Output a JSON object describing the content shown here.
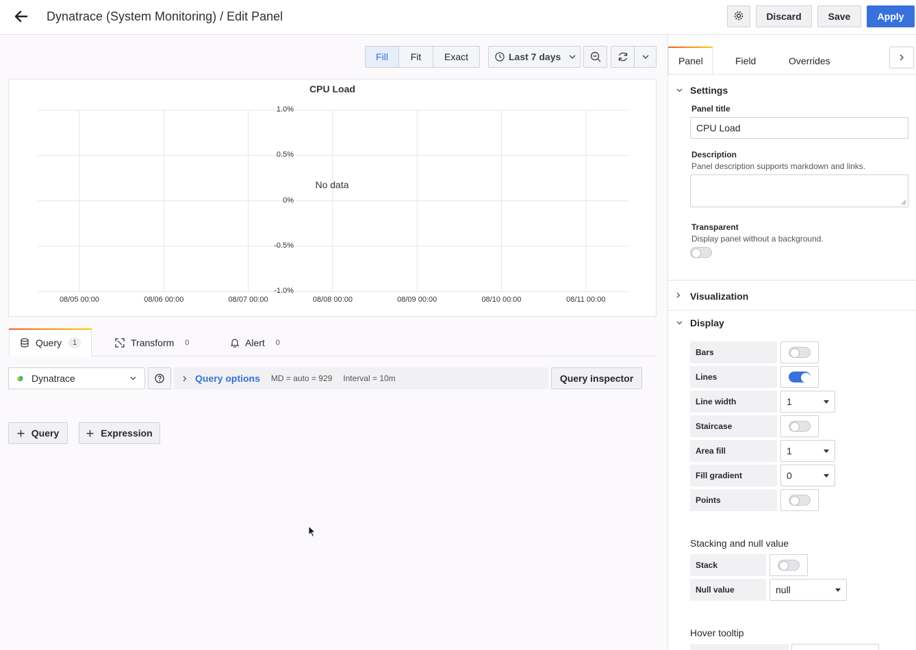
{
  "header": {
    "title": "Dynatrace (System Monitoring) / Edit Panel",
    "discard_label": "Discard",
    "save_label": "Save",
    "apply_label": "Apply"
  },
  "toolbar": {
    "fill_label": "Fill",
    "fit_label": "Fit",
    "exact_label": "Exact",
    "time_range": "Last 7 days"
  },
  "chart_data": {
    "type": "line",
    "title": "CPU Load",
    "message": "No data",
    "y_ticks": [
      "1.0%",
      "0.5%",
      "0%",
      "-0.5%",
      "-1.0%"
    ],
    "ylim": [
      -1.0,
      1.0
    ],
    "x_ticks": [
      "08/05 00:00",
      "08/06 00:00",
      "08/07 00:00",
      "08/08 00:00",
      "08/09 00:00",
      "08/10 00:00",
      "08/11 00:00"
    ],
    "series": [],
    "grid": true
  },
  "query_tabs": [
    {
      "label": "Query",
      "count": "1"
    },
    {
      "label": "Transform",
      "count": "0"
    },
    {
      "label": "Alert",
      "count": "0"
    }
  ],
  "query_row": {
    "datasource": "Dynatrace",
    "options_label": "Query options",
    "md_info": "MD = auto = 929",
    "interval_info": "Interval = 10m",
    "inspector_label": "Query inspector",
    "add_query_label": "Query",
    "add_expression_label": "Expression"
  },
  "right_tabs": [
    "Panel",
    "Field",
    "Overrides"
  ],
  "settings": {
    "section_label": "Settings",
    "panel_title_label": "Panel title",
    "panel_title_value": "CPU Load",
    "description_label": "Description",
    "description_hint": "Panel description supports markdown and links.",
    "description_value": "",
    "transparent_label": "Transparent",
    "transparent_hint": "Display panel without a background."
  },
  "visualization": {
    "section_label": "Visualization"
  },
  "display": {
    "section_label": "Display",
    "bars_label": "Bars",
    "lines_label": "Lines",
    "line_width_label": "Line width",
    "line_width_value": "1",
    "staircase_label": "Staircase",
    "area_fill_label": "Area fill",
    "area_fill_value": "1",
    "fill_gradient_label": "Fill gradient",
    "fill_gradient_value": "0",
    "points_label": "Points"
  },
  "stacking": {
    "heading": "Stacking and null value",
    "stack_label": "Stack",
    "null_value_label": "Null value",
    "null_value_value": "null"
  },
  "hover": {
    "heading": "Hover tooltip"
  },
  "colors": {
    "accent": "#3871dc",
    "tab_accent": "#f05a28"
  }
}
